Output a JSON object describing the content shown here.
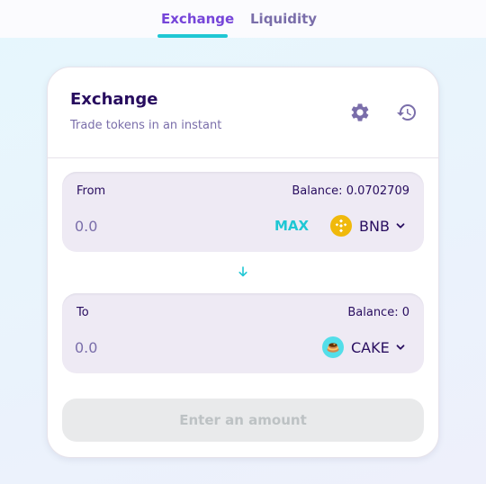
{
  "nav": {
    "tabs": [
      {
        "label": "Exchange",
        "active": true
      },
      {
        "label": "Liquidity",
        "active": false
      }
    ]
  },
  "card": {
    "title": "Exchange",
    "subtitle": "Trade tokens in an instant",
    "icons": [
      "gear-icon",
      "history-icon"
    ]
  },
  "from": {
    "label": "From",
    "balance": "Balance: 0.0702709",
    "placeholder": "0.0",
    "max_label": "MAX",
    "token": {
      "symbol": "BNB",
      "icon": "bnb-logo-icon",
      "color": "#f0b90b"
    }
  },
  "swap": {
    "icon": "arrow-down-icon"
  },
  "to": {
    "label": "To",
    "balance": "Balance: 0",
    "placeholder": "0.0",
    "token": {
      "symbol": "CAKE",
      "icon": "cake-logo-icon",
      "color": "#53dee9"
    }
  },
  "submit": {
    "label": "Enter an amount",
    "disabled": true
  },
  "colors": {
    "primary": "#1fc7d4",
    "secondary": "#7645d9",
    "text": "#280d5f",
    "text_subtle": "#7a6eaa",
    "input_bg": "#eeeaf4",
    "disabled_bg": "#e9eaeb",
    "disabled_text": "#bdc2c4"
  }
}
